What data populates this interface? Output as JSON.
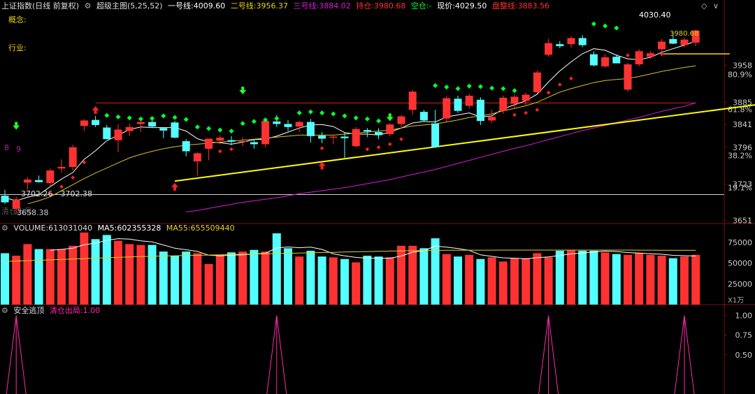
{
  "main_header": {
    "index_name": "上证指数(日线 前复权)",
    "indicator_name": "超级主图(5,25,52)",
    "line1_label": "一号线:",
    "line1_value": "4009.60",
    "line2_label": "二号线:",
    "line2_value": "3956.37",
    "line3_label": "三号线:",
    "line3_value": "3884.02",
    "hold_label": "持仓:",
    "hold_value": "3980.68",
    "empty_label": "空仓:",
    "empty_value": "-",
    "price_label": "现价:",
    "price_value": "4029.50",
    "stop_label": "盘整线:",
    "stop_value": "3883.56"
  },
  "side_labels": {
    "concept": "概念:",
    "industry": "行业:"
  },
  "volume_header": {
    "label": "VOLUME:",
    "value": "613031040",
    "ma5_label": "MA5:",
    "ma5_value": "602355328",
    "ma55_label": "MA55:",
    "ma55_value": "655509440",
    "unit": "X1万"
  },
  "escape_header": {
    "label": "安全逃顶",
    "sub_label": "清仓出局:",
    "sub_value": "1.00"
  },
  "annotations": {
    "peak_price": "4030.40",
    "hold_marker": "3980.68",
    "low_range": "3702.26 - 3702.38",
    "low_price": "3658.38",
    "low_faded": "清仓出局",
    "left_marks": [
      "8",
      "9"
    ]
  },
  "colors": {
    "up": "#ff3232",
    "down": "#54ffff",
    "ma5": "#ffffff",
    "ma25": "#d4c12a",
    "ma52": "#d21fd6",
    "trend": "#ffff00",
    "hold": "#ffd700",
    "stop_line": "#c41a1a",
    "green_dot": "#00ff33",
    "red_dot": "#ff2222",
    "escape_line": "#ff2aa8"
  },
  "chart_data": [
    {
      "type": "candlestick",
      "title": "上证指数(日线 前复权)",
      "ylim": [
        3645,
        4068
      ],
      "price_ticks": [
        3958,
        3885,
        3841,
        3796,
        3723,
        3651
      ],
      "pct_ticks": [
        {
          "label": "80.9%",
          "price": 3940
        },
        {
          "label": "61.8%",
          "price": 3871
        },
        {
          "label": "38.2%",
          "price": 3780
        },
        {
          "label": "19.1%",
          "price": 3716
        }
      ],
      "candles": [
        {
          "o": 3700,
          "h": 3712,
          "l": 3684,
          "c": 3687
        },
        {
          "o": 3674,
          "h": 3698,
          "l": 3663,
          "c": 3693
        },
        {
          "o": 3726,
          "h": 3737,
          "l": 3712,
          "c": 3732
        },
        {
          "o": 3731,
          "h": 3740,
          "l": 3726,
          "c": 3727
        },
        {
          "o": 3725,
          "h": 3754,
          "l": 3718,
          "c": 3750
        },
        {
          "o": 3754,
          "h": 3772,
          "l": 3745,
          "c": 3757
        },
        {
          "o": 3757,
          "h": 3801,
          "l": 3750,
          "c": 3796
        },
        {
          "o": 3838,
          "h": 3852,
          "l": 3828,
          "c": 3849
        },
        {
          "o": 3850,
          "h": 3858,
          "l": 3836,
          "c": 3840
        },
        {
          "o": 3835,
          "h": 3840,
          "l": 3812,
          "c": 3812
        },
        {
          "o": 3810,
          "h": 3842,
          "l": 3786,
          "c": 3831
        },
        {
          "o": 3828,
          "h": 3843,
          "l": 3818,
          "c": 3836
        },
        {
          "o": 3842,
          "h": 3848,
          "l": 3826,
          "c": 3846
        },
        {
          "o": 3846,
          "h": 3851,
          "l": 3834,
          "c": 3837
        },
        {
          "o": 3834,
          "h": 3836,
          "l": 3814,
          "c": 3829
        },
        {
          "o": 3845,
          "h": 3848,
          "l": 3814,
          "c": 3815
        },
        {
          "o": 3808,
          "h": 3812,
          "l": 3778,
          "c": 3788
        },
        {
          "o": 3768,
          "h": 3786,
          "l": 3740,
          "c": 3784
        },
        {
          "o": 3793,
          "h": 3810,
          "l": 3770,
          "c": 3813
        },
        {
          "o": 3809,
          "h": 3820,
          "l": 3802,
          "c": 3815
        },
        {
          "o": 3810,
          "h": 3818,
          "l": 3800,
          "c": 3807
        },
        {
          "o": 3807,
          "h": 3816,
          "l": 3798,
          "c": 3808
        },
        {
          "o": 3806,
          "h": 3810,
          "l": 3793,
          "c": 3802
        },
        {
          "o": 3802,
          "h": 3850,
          "l": 3796,
          "c": 3848
        },
        {
          "o": 3847,
          "h": 3860,
          "l": 3836,
          "c": 3842
        },
        {
          "o": 3842,
          "h": 3850,
          "l": 3828,
          "c": 3836
        },
        {
          "o": 3837,
          "h": 3848,
          "l": 3826,
          "c": 3846
        },
        {
          "o": 3846,
          "h": 3852,
          "l": 3805,
          "c": 3818
        },
        {
          "o": 3819,
          "h": 3826,
          "l": 3804,
          "c": 3813
        },
        {
          "o": 3815,
          "h": 3820,
          "l": 3802,
          "c": 3817
        },
        {
          "o": 3817,
          "h": 3825,
          "l": 3775,
          "c": 3814
        },
        {
          "o": 3798,
          "h": 3836,
          "l": 3796,
          "c": 3832
        },
        {
          "o": 3830,
          "h": 3834,
          "l": 3816,
          "c": 3827
        },
        {
          "o": 3826,
          "h": 3834,
          "l": 3812,
          "c": 3820
        },
        {
          "o": 3822,
          "h": 3844,
          "l": 3818,
          "c": 3841
        },
        {
          "o": 3842,
          "h": 3860,
          "l": 3836,
          "c": 3857
        },
        {
          "o": 3870,
          "h": 3910,
          "l": 3860,
          "c": 3906
        },
        {
          "o": 3866,
          "h": 3870,
          "l": 3848,
          "c": 3849
        },
        {
          "o": 3843,
          "h": 3870,
          "l": 3795,
          "c": 3796
        },
        {
          "o": 3853,
          "h": 3897,
          "l": 3846,
          "c": 3893
        },
        {
          "o": 3892,
          "h": 3898,
          "l": 3864,
          "c": 3868
        },
        {
          "o": 3878,
          "h": 3902,
          "l": 3872,
          "c": 3898
        },
        {
          "o": 3890,
          "h": 3895,
          "l": 3840,
          "c": 3848
        },
        {
          "o": 3849,
          "h": 3870,
          "l": 3844,
          "c": 3856
        },
        {
          "o": 3868,
          "h": 3898,
          "l": 3862,
          "c": 3894
        },
        {
          "o": 3882,
          "h": 3900,
          "l": 3873,
          "c": 3896
        },
        {
          "o": 3888,
          "h": 3904,
          "l": 3880,
          "c": 3900
        },
        {
          "o": 3905,
          "h": 3948,
          "l": 3902,
          "c": 3944
        },
        {
          "o": 3979,
          "h": 4010,
          "l": 3975,
          "c": 4002
        },
        {
          "o": 4000,
          "h": 4006,
          "l": 3992,
          "c": 3996
        },
        {
          "o": 4000,
          "h": 4016,
          "l": 3993,
          "c": 4012
        },
        {
          "o": 4012,
          "h": 4018,
          "l": 3994,
          "c": 3998
        },
        {
          "o": 3980,
          "h": 3986,
          "l": 3956,
          "c": 3958
        },
        {
          "o": 3956,
          "h": 3980,
          "l": 3953,
          "c": 3974
        },
        {
          "o": 3975,
          "h": 3980,
          "l": 3965,
          "c": 3962
        },
        {
          "o": 3910,
          "h": 3963,
          "l": 3906,
          "c": 3960
        },
        {
          "o": 3960,
          "h": 3990,
          "l": 3956,
          "c": 3986
        },
        {
          "o": 3975,
          "h": 3986,
          "l": 3971,
          "c": 3982
        },
        {
          "o": 3990,
          "h": 4010,
          "l": 3984,
          "c": 4005
        },
        {
          "o": 4010,
          "h": 4023,
          "l": 4000,
          "c": 4001
        },
        {
          "o": 3998,
          "h": 4012,
          "l": 3994,
          "c": 4009
        },
        {
          "o": 4003,
          "h": 4029,
          "l": 3996,
          "c": 4027
        }
      ],
      "ma_series": [
        {
          "name": "一号线",
          "values": [
            3696,
            3690,
            3697,
            3702,
            3718,
            3733,
            3746,
            3772,
            3789,
            3809,
            3820,
            3831,
            3836,
            3835,
            3835,
            3835,
            3828,
            3813,
            3806,
            3805,
            3802,
            3806,
            3811,
            3812,
            3818,
            3826,
            3834,
            3840,
            3841,
            3837,
            3825,
            3822,
            3822,
            3820,
            3826,
            3834,
            3844,
            3847,
            3846,
            3856,
            3860,
            3864,
            3856,
            3858,
            3872,
            3880,
            3888,
            3901,
            3925,
            3947,
            3965,
            3981,
            3991,
            3988,
            3978,
            3971,
            3969,
            3974,
            3984,
            3991,
            3998,
            4006
          ]
        },
        {
          "name": "二号线",
          "values": [
            null,
            null,
            3684,
            3690,
            3698,
            3710,
            3722,
            3734,
            3745,
            3755,
            3765,
            3775,
            3782,
            3788,
            3793,
            3797,
            3800,
            3802,
            3804,
            3806,
            3808,
            3810,
            3812,
            3814,
            3816,
            3818,
            3820,
            3820,
            3820,
            3820,
            3822,
            3824,
            3826,
            3828,
            3830,
            3834,
            3838,
            3840,
            3842,
            3846,
            3850,
            3855,
            3858,
            3862,
            3868,
            3873,
            3878,
            3885,
            3895,
            3905,
            3912,
            3918,
            3924,
            3928,
            3930,
            3932,
            3936,
            3941,
            3946,
            3950,
            3954,
            3957
          ]
        },
        {
          "name": "三号线",
          "values": [
            null,
            null,
            null,
            null,
            null,
            null,
            null,
            null,
            null,
            null,
            null,
            null,
            null,
            null,
            null,
            null,
            3668,
            3671,
            3675,
            3679,
            3683,
            3687,
            3690,
            3693,
            3696,
            3700,
            3704,
            3707,
            3710,
            3713,
            3716,
            3720,
            3724,
            3728,
            3732,
            3737,
            3742,
            3747,
            3752,
            3758,
            3764,
            3770,
            3776,
            3782,
            3788,
            3794,
            3799,
            3805,
            3811,
            3817,
            3823,
            3829,
            3834,
            3839,
            3845,
            3850,
            3855,
            3861,
            3867,
            3872,
            3877,
            3884
          ]
        }
      ],
      "trend_line": {
        "from_index": 15,
        "from_value": 3729,
        "to_index": 68,
        "to_value": 3885
      },
      "stop_line_value": 3883.56,
      "low_line_value": 3702.3,
      "hold_line": {
        "from_index": 58,
        "to_index": 64,
        "value": 3980.68
      },
      "green_dots": [
        {
          "i": 9,
          "v": 3859
        },
        {
          "i": 10,
          "v": 3856
        },
        {
          "i": 11,
          "v": 3854
        },
        {
          "i": 12,
          "v": 3852
        },
        {
          "i": 13,
          "v": 3853
        },
        {
          "i": 14,
          "v": 3858
        },
        {
          "i": 15,
          "v": 3855
        },
        {
          "i": 16,
          "v": 3851
        },
        {
          "i": 17,
          "v": 3836
        },
        {
          "i": 18,
          "v": 3833
        },
        {
          "i": 19,
          "v": 3830
        },
        {
          "i": 20,
          "v": 3828
        },
        {
          "i": 21,
          "v": 3843
        },
        {
          "i": 22,
          "v": 3847
        },
        {
          "i": 23,
          "v": 3850
        },
        {
          "i": 24,
          "v": 3853
        },
        {
          "i": 26,
          "v": 3864
        },
        {
          "i": 27,
          "v": 3866
        },
        {
          "i": 28,
          "v": 3864
        },
        {
          "i": 29,
          "v": 3862
        },
        {
          "i": 30,
          "v": 3858
        },
        {
          "i": 31,
          "v": 3854
        },
        {
          "i": 32,
          "v": 3852
        },
        {
          "i": 33,
          "v": 3848
        },
        {
          "i": 38,
          "v": 3918
        },
        {
          "i": 39,
          "v": 3915
        },
        {
          "i": 40,
          "v": 3912
        },
        {
          "i": 41,
          "v": 3917
        },
        {
          "i": 42,
          "v": 3916
        },
        {
          "i": 43,
          "v": 3913
        },
        {
          "i": 44,
          "v": 3912
        },
        {
          "i": 45,
          "v": 3908
        },
        {
          "i": 52,
          "v": 4040
        },
        {
          "i": 53,
          "v": 4036
        },
        {
          "i": 54,
          "v": 4032
        }
      ],
      "red_dots": [
        {
          "i": 4,
          "v": 3702
        },
        {
          "i": 5,
          "v": 3718
        },
        {
          "i": 6,
          "v": 3736
        },
        {
          "i": 7,
          "v": 3766
        },
        {
          "i": 19,
          "v": 3788
        },
        {
          "i": 20,
          "v": 3792
        },
        {
          "i": 28,
          "v": 3794
        },
        {
          "i": 32,
          "v": 3792
        },
        {
          "i": 33,
          "v": 3796
        },
        {
          "i": 34,
          "v": 3802
        },
        {
          "i": 35,
          "v": 3812
        },
        {
          "i": 45,
          "v": 3860
        },
        {
          "i": 46,
          "v": 3864
        },
        {
          "i": 47,
          "v": 3870
        },
        {
          "i": 48,
          "v": 3904
        },
        {
          "i": 49,
          "v": 3920
        },
        {
          "i": 50,
          "v": 3932
        },
        {
          "i": 55,
          "v": 3978
        },
        {
          "i": 56,
          "v": 3984
        },
        {
          "i": 57,
          "v": 3978
        },
        {
          "i": 58,
          "v": 3980
        }
      ],
      "up_arrows": [
        {
          "i": 8,
          "v": 3869
        },
        {
          "i": 15,
          "v": 3717
        },
        {
          "i": 28,
          "v": 3759
        }
      ],
      "down_arrows": [
        {
          "i": 1,
          "v": 3839
        },
        {
          "i": 21,
          "v": 3909
        },
        {
          "i": 34,
          "v": 3856
        }
      ]
    },
    {
      "type": "bar",
      "title": "VOLUME",
      "unit": "X1万",
      "ylim": [
        0,
        86000
      ],
      "y_ticks": [
        75000,
        50000,
        25000
      ],
      "values": [
        62000,
        59000,
        73000,
        67000,
        67000,
        67000,
        71000,
        87000,
        79000,
        84000,
        77000,
        73000,
        72000,
        72000,
        64000,
        59000,
        64000,
        62000,
        49000,
        60000,
        63000,
        64000,
        66000,
        64000,
        86000,
        68000,
        58000,
        65000,
        58000,
        57000,
        55000,
        51000,
        59000,
        58000,
        57000,
        71000,
        71000,
        68000,
        80000,
        61000,
        58000,
        60000,
        55000,
        57000,
        52000,
        56000,
        56000,
        62000,
        57000,
        65000,
        66000,
        65000,
        65000,
        63000,
        61000,
        60000,
        62000,
        60000,
        59000,
        56000,
        58000,
        60000
      ],
      "ma5": [
        null,
        null,
        null,
        null,
        65600,
        66600,
        68000,
        72200,
        74200,
        77600,
        79600,
        79000,
        77000,
        75600,
        72000,
        68000,
        66200,
        64200,
        59600,
        58800,
        59600,
        60000,
        61000,
        62000,
        68400,
        69600,
        68600,
        69400,
        66600,
        61200,
        58800,
        57000,
        56000,
        56000,
        56000,
        58600,
        63200,
        65000,
        70600,
        69400,
        67600,
        65400,
        60000,
        58200,
        56400,
        56000,
        55200,
        56600,
        57600,
        59200,
        61200,
        62200,
        63600,
        64600,
        64000,
        62800,
        62200,
        61400,
        60800,
        59400,
        59000,
        58600
      ],
      "ma55": [
        52000,
        52500,
        53000,
        53500,
        54000,
        54500,
        55000,
        55500,
        56000,
        56500,
        57000,
        57500,
        58000,
        58300,
        58600,
        58900,
        59200,
        59500,
        59800,
        60100,
        60400,
        60700,
        61000,
        61300,
        61600,
        61900,
        62200,
        62500,
        62800,
        63100,
        63400,
        63700,
        64000,
        64300,
        64600,
        64800,
        65000,
        65200,
        65400,
        65500,
        65600,
        65650,
        65700,
        65720,
        65740,
        65750,
        65760,
        65770,
        65780,
        65790,
        65800,
        65800,
        65800,
        65780,
        65760,
        65740,
        65700,
        65660,
        65620,
        65580,
        65560,
        65550
      ]
    },
    {
      "type": "line",
      "title": "安全逃顶",
      "ylim": [
        0,
        1.05
      ],
      "y_ticks": [
        "1.00",
        "0.75",
        "0.50"
      ],
      "spikes": [
        1,
        24,
        48,
        60
      ],
      "spike_value": 1.0
    }
  ]
}
